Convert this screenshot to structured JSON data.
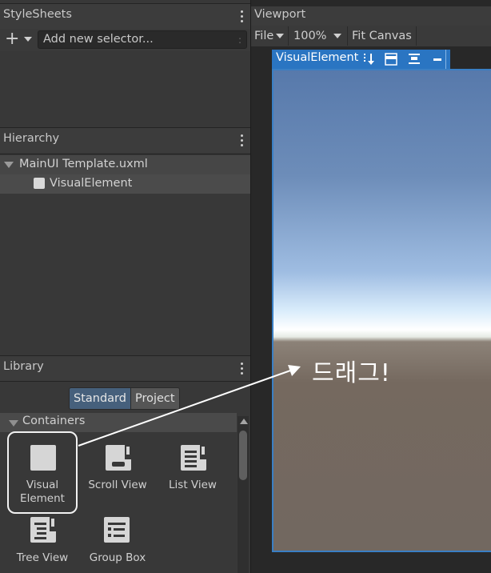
{
  "stylesheets": {
    "title": "StyleSheets",
    "selector_placeholder": "Add new selector..."
  },
  "hierarchy": {
    "title": "Hierarchy",
    "root": "MainUI Template.uxml",
    "child": "VisualElement"
  },
  "library": {
    "title": "Library",
    "tabs": [
      {
        "label": "Standard",
        "active": true
      },
      {
        "label": "Project",
        "active": false
      }
    ],
    "section": "Containers",
    "items": [
      {
        "label": "Visual Element",
        "icon": "visual-element-icon"
      },
      {
        "label": "Scroll View",
        "icon": "scroll-view-icon"
      },
      {
        "label": "List View",
        "icon": "list-view-icon"
      },
      {
        "label": "Tree View",
        "icon": "tree-view-icon"
      },
      {
        "label": "Group Box",
        "icon": "group-box-icon"
      }
    ]
  },
  "viewport": {
    "title": "Viewport",
    "file_menu": "File",
    "zoom": "100%",
    "fit_canvas": "Fit Canvas",
    "element_tab": "VisualElement"
  },
  "annotation": {
    "text": "드래그!",
    "color": "#ffffff"
  },
  "colors": {
    "selection_blue": "#2a75c2",
    "standard_tab": "#46607c"
  }
}
